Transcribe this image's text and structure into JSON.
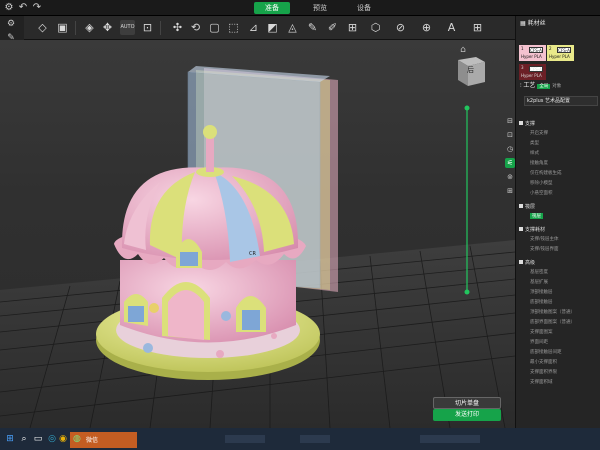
{
  "titlebar": {
    "icons": [
      "settings-icon",
      "undo-icon",
      "redo-icon"
    ],
    "tabs": [
      {
        "label": "准备",
        "active": true
      },
      {
        "label": "预览",
        "active": false
      },
      {
        "label": "设备",
        "active": false
      }
    ]
  },
  "toolbar": {
    "tools": [
      "cube-add-icon",
      "save-icon",
      "object-list-icon",
      "move-icon",
      "rotate-icon",
      "auto-layout-icon",
      "scale-icon",
      "layout-icon",
      "cut-icon",
      "lay-flat-icon",
      "split-icon",
      "seam-icon",
      "support-paint-icon",
      "mesh-icon",
      "text-icon",
      "arrange-icon"
    ],
    "auto_label": "AUTO"
  },
  "left_panel": {
    "icons": [
      "settings-icon",
      "pen-icon",
      "wifi-icon"
    ]
  },
  "viewport": {
    "view_cube_label": "后",
    "home_icon": "home-icon",
    "bed_label": "CR",
    "slice_single_label": "切片单盘",
    "slice_all_label": "发送打印"
  },
  "right_panel": {
    "filament_title": "耗材丝",
    "slots": [
      {
        "num": "1",
        "badge": "CFS-A",
        "material": "Hyper PLA",
        "color": "#f4c2cf"
      },
      {
        "num": "2",
        "badge": "CFS-A",
        "material": "Hyper PLA",
        "color": "#e9e98a"
      },
      {
        "num": "3",
        "badge": "CFS-A",
        "material": "Hyper PLA",
        "color": "#6b1f26"
      }
    ],
    "process_title": "工艺",
    "process_tag_global": "全局",
    "process_tag_object": "对象",
    "process_preset": "k2plus 艺术品配置",
    "sections": [
      {
        "title": "支撑",
        "items": [
          "开启支撑",
          "类型",
          "样式",
          "接触角度",
          "仅在构建板生成",
          "移除小模型",
          "小悬空面积"
        ]
      },
      {
        "title": "筏层",
        "items": [
          "筏层"
        ]
      },
      {
        "title": "支撑耗材",
        "items": [
          "支撑/筏层主体",
          "支撑/筏层界面"
        ]
      },
      {
        "title": "高级",
        "items": [
          "基层密度",
          "基层扩展",
          "顶部接触层",
          "底部接触层",
          "顶部接触图案（普通）",
          "底部界面图案（普通）",
          "支撑面图案",
          "界面间距",
          "底部接触层间距",
          "最小支撑面积",
          "支撑面积界限",
          "支撑面积域"
        ]
      }
    ],
    "side_icons": [
      "quality-icon",
      "shell-icon",
      "speed-icon",
      "support-icon",
      "multi-material-icon",
      "other-icon"
    ]
  },
  "taskbar": {
    "icons": [
      "windows-start-icon",
      "search-icon",
      "task-view-icon",
      "edge-icon",
      "chrome-icon"
    ],
    "app_label": "微信"
  },
  "colors": {
    "accent": "#16a34a",
    "pink": "#f2b3c9",
    "yellow": "#dbe07a",
    "blue": "#a9c6e6"
  }
}
